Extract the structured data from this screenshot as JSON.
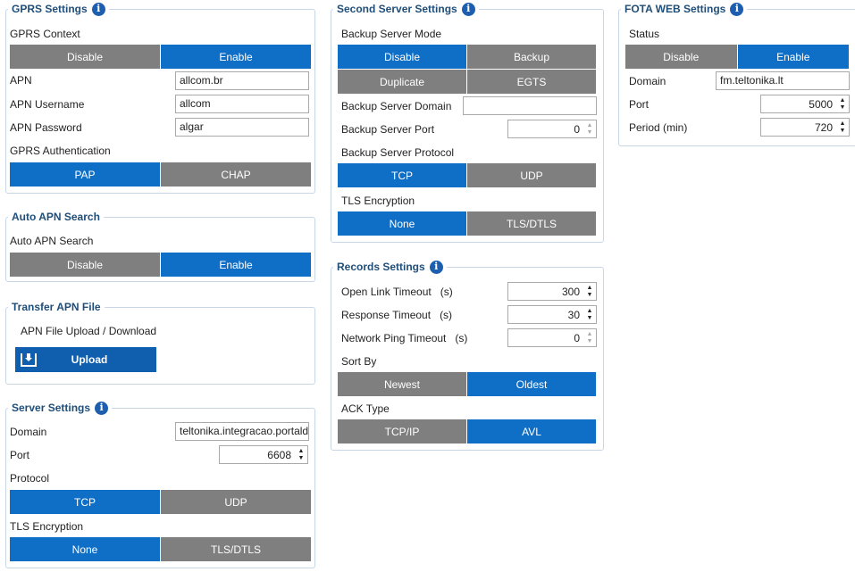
{
  "gprs": {
    "title": "GPRS Settings",
    "context_label": "GPRS Context",
    "context_options": [
      "Disable",
      "Enable"
    ],
    "apn_label": "APN",
    "apn_value": "allcom.br",
    "username_label": "APN Username",
    "username_value": "allcom",
    "password_label": "APN Password",
    "password_value": "algar",
    "auth_label": "GPRS Authentication",
    "auth_options": [
      "PAP",
      "CHAP"
    ]
  },
  "auto_apn": {
    "title": "Auto APN Search",
    "label": "Auto APN Search",
    "options": [
      "Disable",
      "Enable"
    ]
  },
  "transfer": {
    "title": "Transfer APN File",
    "label": "APN File Upload / Download",
    "upload_label": "Upload"
  },
  "server": {
    "title": "Server Settings",
    "domain_label": "Domain",
    "domain_value": "teltonika.integracao.portaldo",
    "port_label": "Port",
    "port_value": "6608",
    "protocol_label": "Protocol",
    "protocol_options": [
      "TCP",
      "UDP"
    ],
    "tls_label": "TLS Encryption",
    "tls_options": [
      "None",
      "TLS/DTLS"
    ]
  },
  "second_server": {
    "title": "Second Server Settings",
    "mode_label": "Backup Server Mode",
    "mode_options": [
      "Disable",
      "Backup",
      "Duplicate",
      "EGTS"
    ],
    "domain_label": "Backup Server Domain",
    "domain_value": "",
    "port_label": "Backup Server Port",
    "port_value": "0",
    "protocol_label": "Backup Server Protocol",
    "protocol_options": [
      "TCP",
      "UDP"
    ],
    "tls_label": "TLS Encryption",
    "tls_options": [
      "None",
      "TLS/DTLS"
    ]
  },
  "records": {
    "title": "Records Settings",
    "open_link_label": "Open Link Timeout",
    "open_link_unit": "(s)",
    "open_link_value": "300",
    "response_label": "Response Timeout",
    "response_unit": "(s)",
    "response_value": "30",
    "ping_label": "Network Ping Timeout",
    "ping_unit": "(s)",
    "ping_value": "0",
    "sort_label": "Sort By",
    "sort_options": [
      "Newest",
      "Oldest"
    ],
    "ack_label": "ACK Type",
    "ack_options": [
      "TCP/IP",
      "AVL"
    ]
  },
  "fota": {
    "title": "FOTA WEB Settings",
    "status_label": "Status",
    "status_options": [
      "Disable",
      "Enable"
    ],
    "domain_label": "Domain",
    "domain_value": "fm.teltonika.lt",
    "port_label": "Port",
    "port_value": "5000",
    "period_label": "Period (min)",
    "period_value": "720"
  },
  "colors": {
    "selected": "#0f6fc6",
    "unselected": "#7f7f7f",
    "title": "#1f4e79",
    "info": "#1d5fae"
  },
  "icons": {
    "info": "info-icon",
    "upload": "upload-icon",
    "spinner": "spinner-arrows-icon"
  }
}
